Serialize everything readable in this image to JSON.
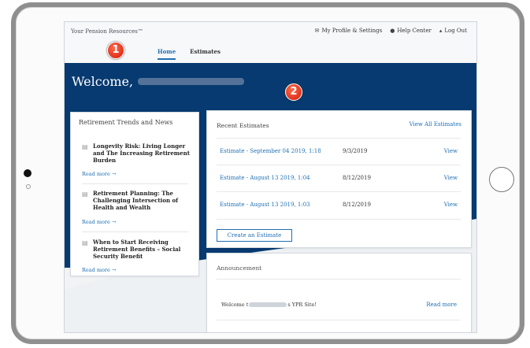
{
  "site": {
    "name": "Your Pension Resources™",
    "util_links": [
      {
        "icon": "envelope-icon",
        "glyph": "✉",
        "label": "My Profile & Settings"
      },
      {
        "icon": "help-icon",
        "glyph": "●",
        "label": "Help Center"
      },
      {
        "icon": "lock-icon",
        "glyph": "▴",
        "label": "Log Out"
      }
    ]
  },
  "nav": {
    "tabs": [
      {
        "label": "Home",
        "active": true
      },
      {
        "label": "Estimates",
        "active": false
      }
    ]
  },
  "hero": {
    "welcome": "Welcome,"
  },
  "markers": {
    "one": "1",
    "two": "2"
  },
  "trends": {
    "title": "Retirement Trends and News",
    "items": [
      {
        "title": "Longevity Risk: Living Longer and The Increasing Retirement Burden",
        "more": "Read more →"
      },
      {
        "title": "Retirement Planning: The Challenging Intersection of Health and Wealth",
        "more": "Read more →"
      },
      {
        "title": "When to Start Receiving Retirement Benefits – Social Security Benefit",
        "more": "Read more →"
      }
    ]
  },
  "estimates": {
    "title": "Recent Estimates",
    "view_all": "View All Estimates",
    "rows": [
      {
        "name": "Estimate - September 04 2019, 1:18",
        "date": "9/3/2019",
        "action": "View"
      },
      {
        "name": "Estimate - August 13 2019, 1:04",
        "date": "8/12/2019",
        "action": "View"
      },
      {
        "name": "Estimate - August 13 2019, 1:03",
        "date": "8/12/2019",
        "action": "View"
      }
    ],
    "create_label": "Create an Estimate"
  },
  "announcement": {
    "title": "Announcement",
    "text_before": "Welcome t",
    "text_after": "s YPR Site!",
    "read_more": "Read more"
  },
  "colors": {
    "hero": "#063a70",
    "link": "#1f6fb2",
    "marker": "#d21b0d"
  }
}
